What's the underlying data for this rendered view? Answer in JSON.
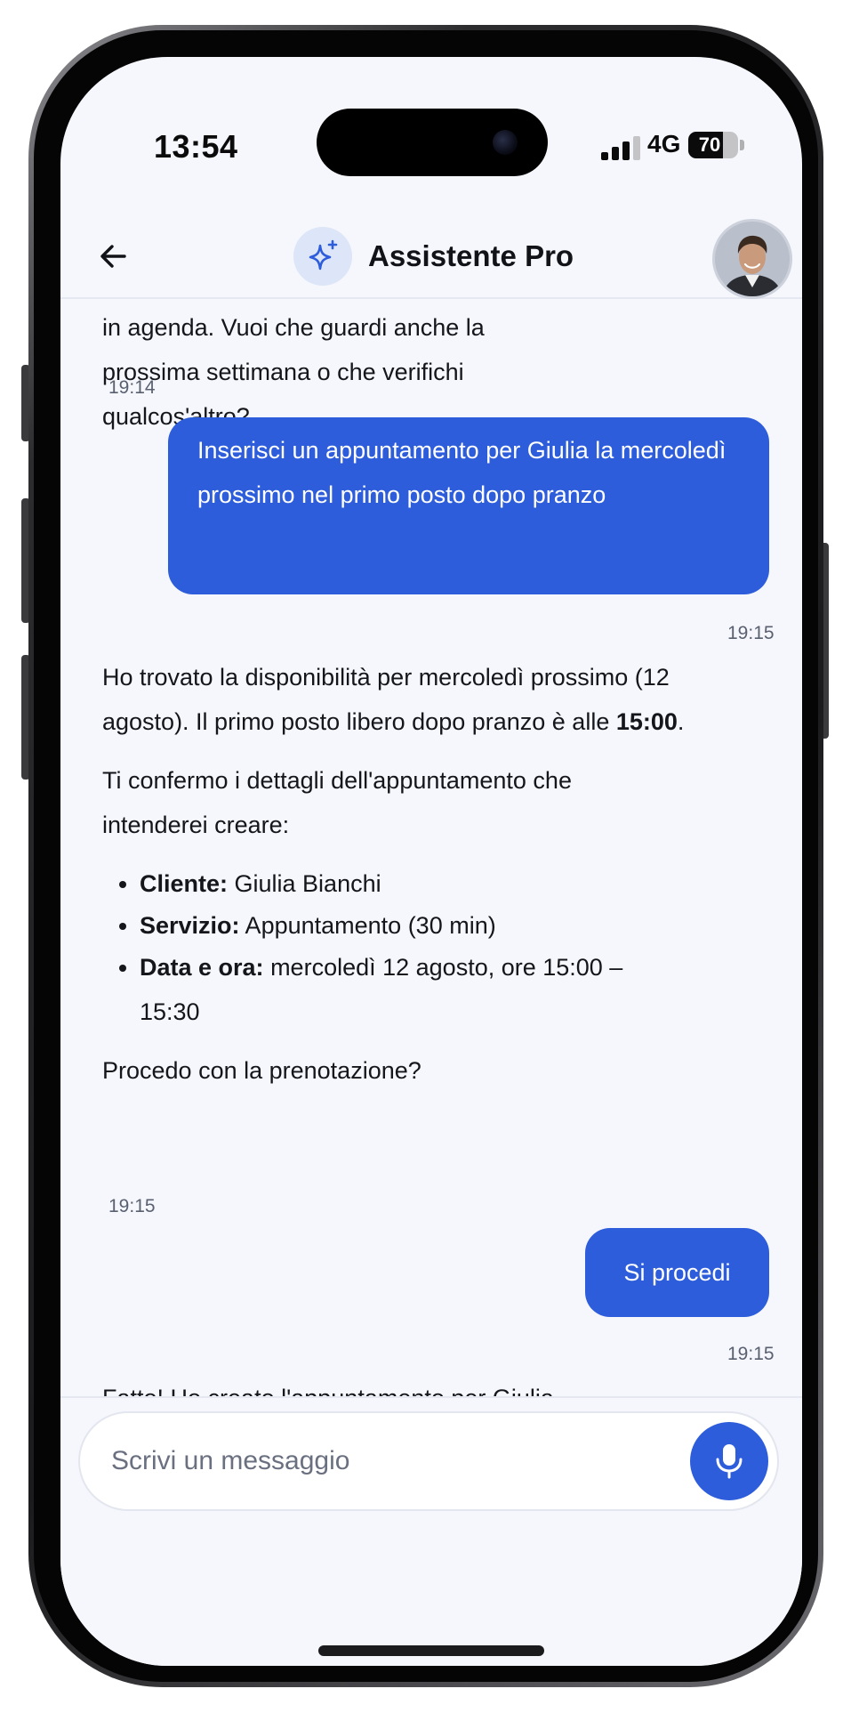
{
  "status": {
    "time": "13:54",
    "network": "4G",
    "battery": "70",
    "battery_level": 0.7
  },
  "header": {
    "title": "Assistente Pro",
    "ai_icon": "sparkles-icon",
    "back_icon": "arrow-left-icon",
    "avatar_icon": "user-avatar"
  },
  "chat": {
    "msg1_text": "Questa settimana hai un solo appuntamento in agenda. Vuoi che guardi anche la prossima settimana o che verifichi qualcos'altro?",
    "msg1_time": "19:14",
    "msg2_text": "Inserisci un appuntamento per Giulia la mercoledì prossimo nel primo posto dopo pranzo",
    "msg2_time": "19:15",
    "msg3_intro": "Ho trovato la disponibilità per mercoledì prossimo (12 agosto). Il primo posto libero dopo pranzo è alle ",
    "msg3_time_bold": "15:00",
    "msg3_period": ".",
    "msg3_confirm": "Ti confermo i dettagli dell'appuntamento che intenderei creare:",
    "msg3_items": [
      {
        "label": "Cliente:",
        "value": " Giulia Bianchi"
      },
      {
        "label": "Servizio:",
        "value": " Appuntamento (30 min)"
      },
      {
        "label": "Data e ora:",
        "value": " mercoledì 12 agosto, ore 15:00 – 15:30"
      }
    ],
    "msg3_question": "Procedo con la prenotazione?",
    "msg3_time": "19:15",
    "msg4_text": "Si procedi",
    "msg4_time": "19:15",
    "msg5_text": "Fatto! Ho creato l'appuntamento per Giulia Bianchi:"
  },
  "composer": {
    "placeholder": "Scrivi un messaggio",
    "mic_icon": "microphone-icon"
  },
  "colors": {
    "accent": "#2d5ddb",
    "background": "#f5f7fc"
  }
}
